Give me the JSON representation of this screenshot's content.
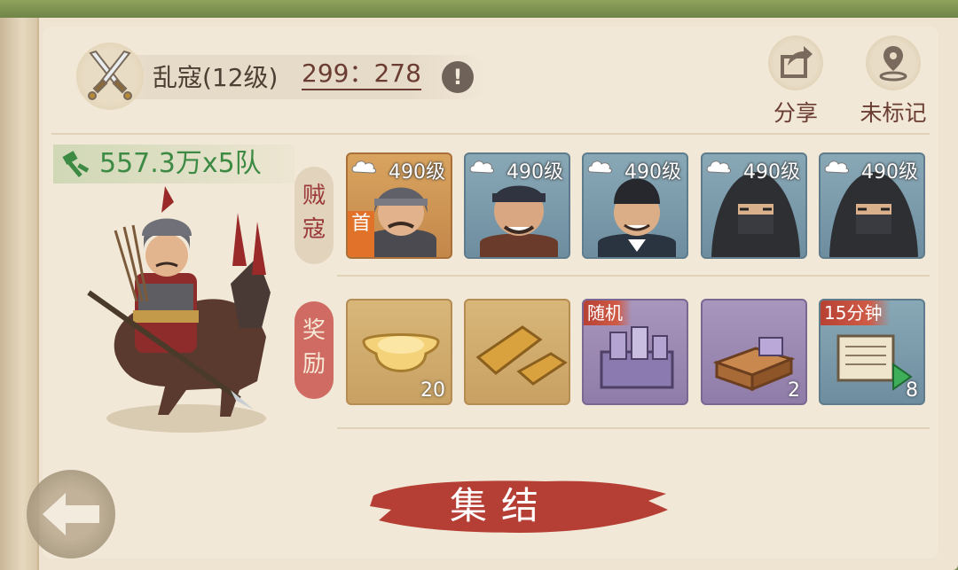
{
  "header": {
    "enemy_name": "乱寇(12级)",
    "coords": "299：278",
    "info_symbol": "!"
  },
  "actions": {
    "share_label": "分享",
    "unmarked_label": "未标记"
  },
  "power": {
    "text": "557.3万x5队"
  },
  "sections": {
    "enemies_label": "贼\n寇",
    "rewards_label": "奖\n励"
  },
  "enemies": [
    {
      "level": "490级",
      "leader": "首",
      "art": "helmet-warrior"
    },
    {
      "level": "490级",
      "art": "bandana-bandit"
    },
    {
      "level": "490级",
      "art": "hat-bandit"
    },
    {
      "level": "490级",
      "art": "hooded-assassin"
    },
    {
      "level": "490级",
      "art": "hooded-assassin"
    }
  ],
  "rewards": [
    {
      "item": "gold-ingot",
      "count": "20"
    },
    {
      "item": "gold-bars",
      "count": ""
    },
    {
      "item": "random-chest",
      "tag": "随机",
      "count": ""
    },
    {
      "item": "supply-box",
      "count": "2"
    },
    {
      "item": "speedup-scroll",
      "tag": "15分钟",
      "count": "8"
    }
  ],
  "rally": {
    "label": "集结"
  },
  "colors": {
    "parchment": "#efe4d1",
    "accent_red": "#b74133",
    "power_green": "#3c8a43",
    "card_blue": "#7d9cab",
    "card_purple": "#9a88b2"
  }
}
